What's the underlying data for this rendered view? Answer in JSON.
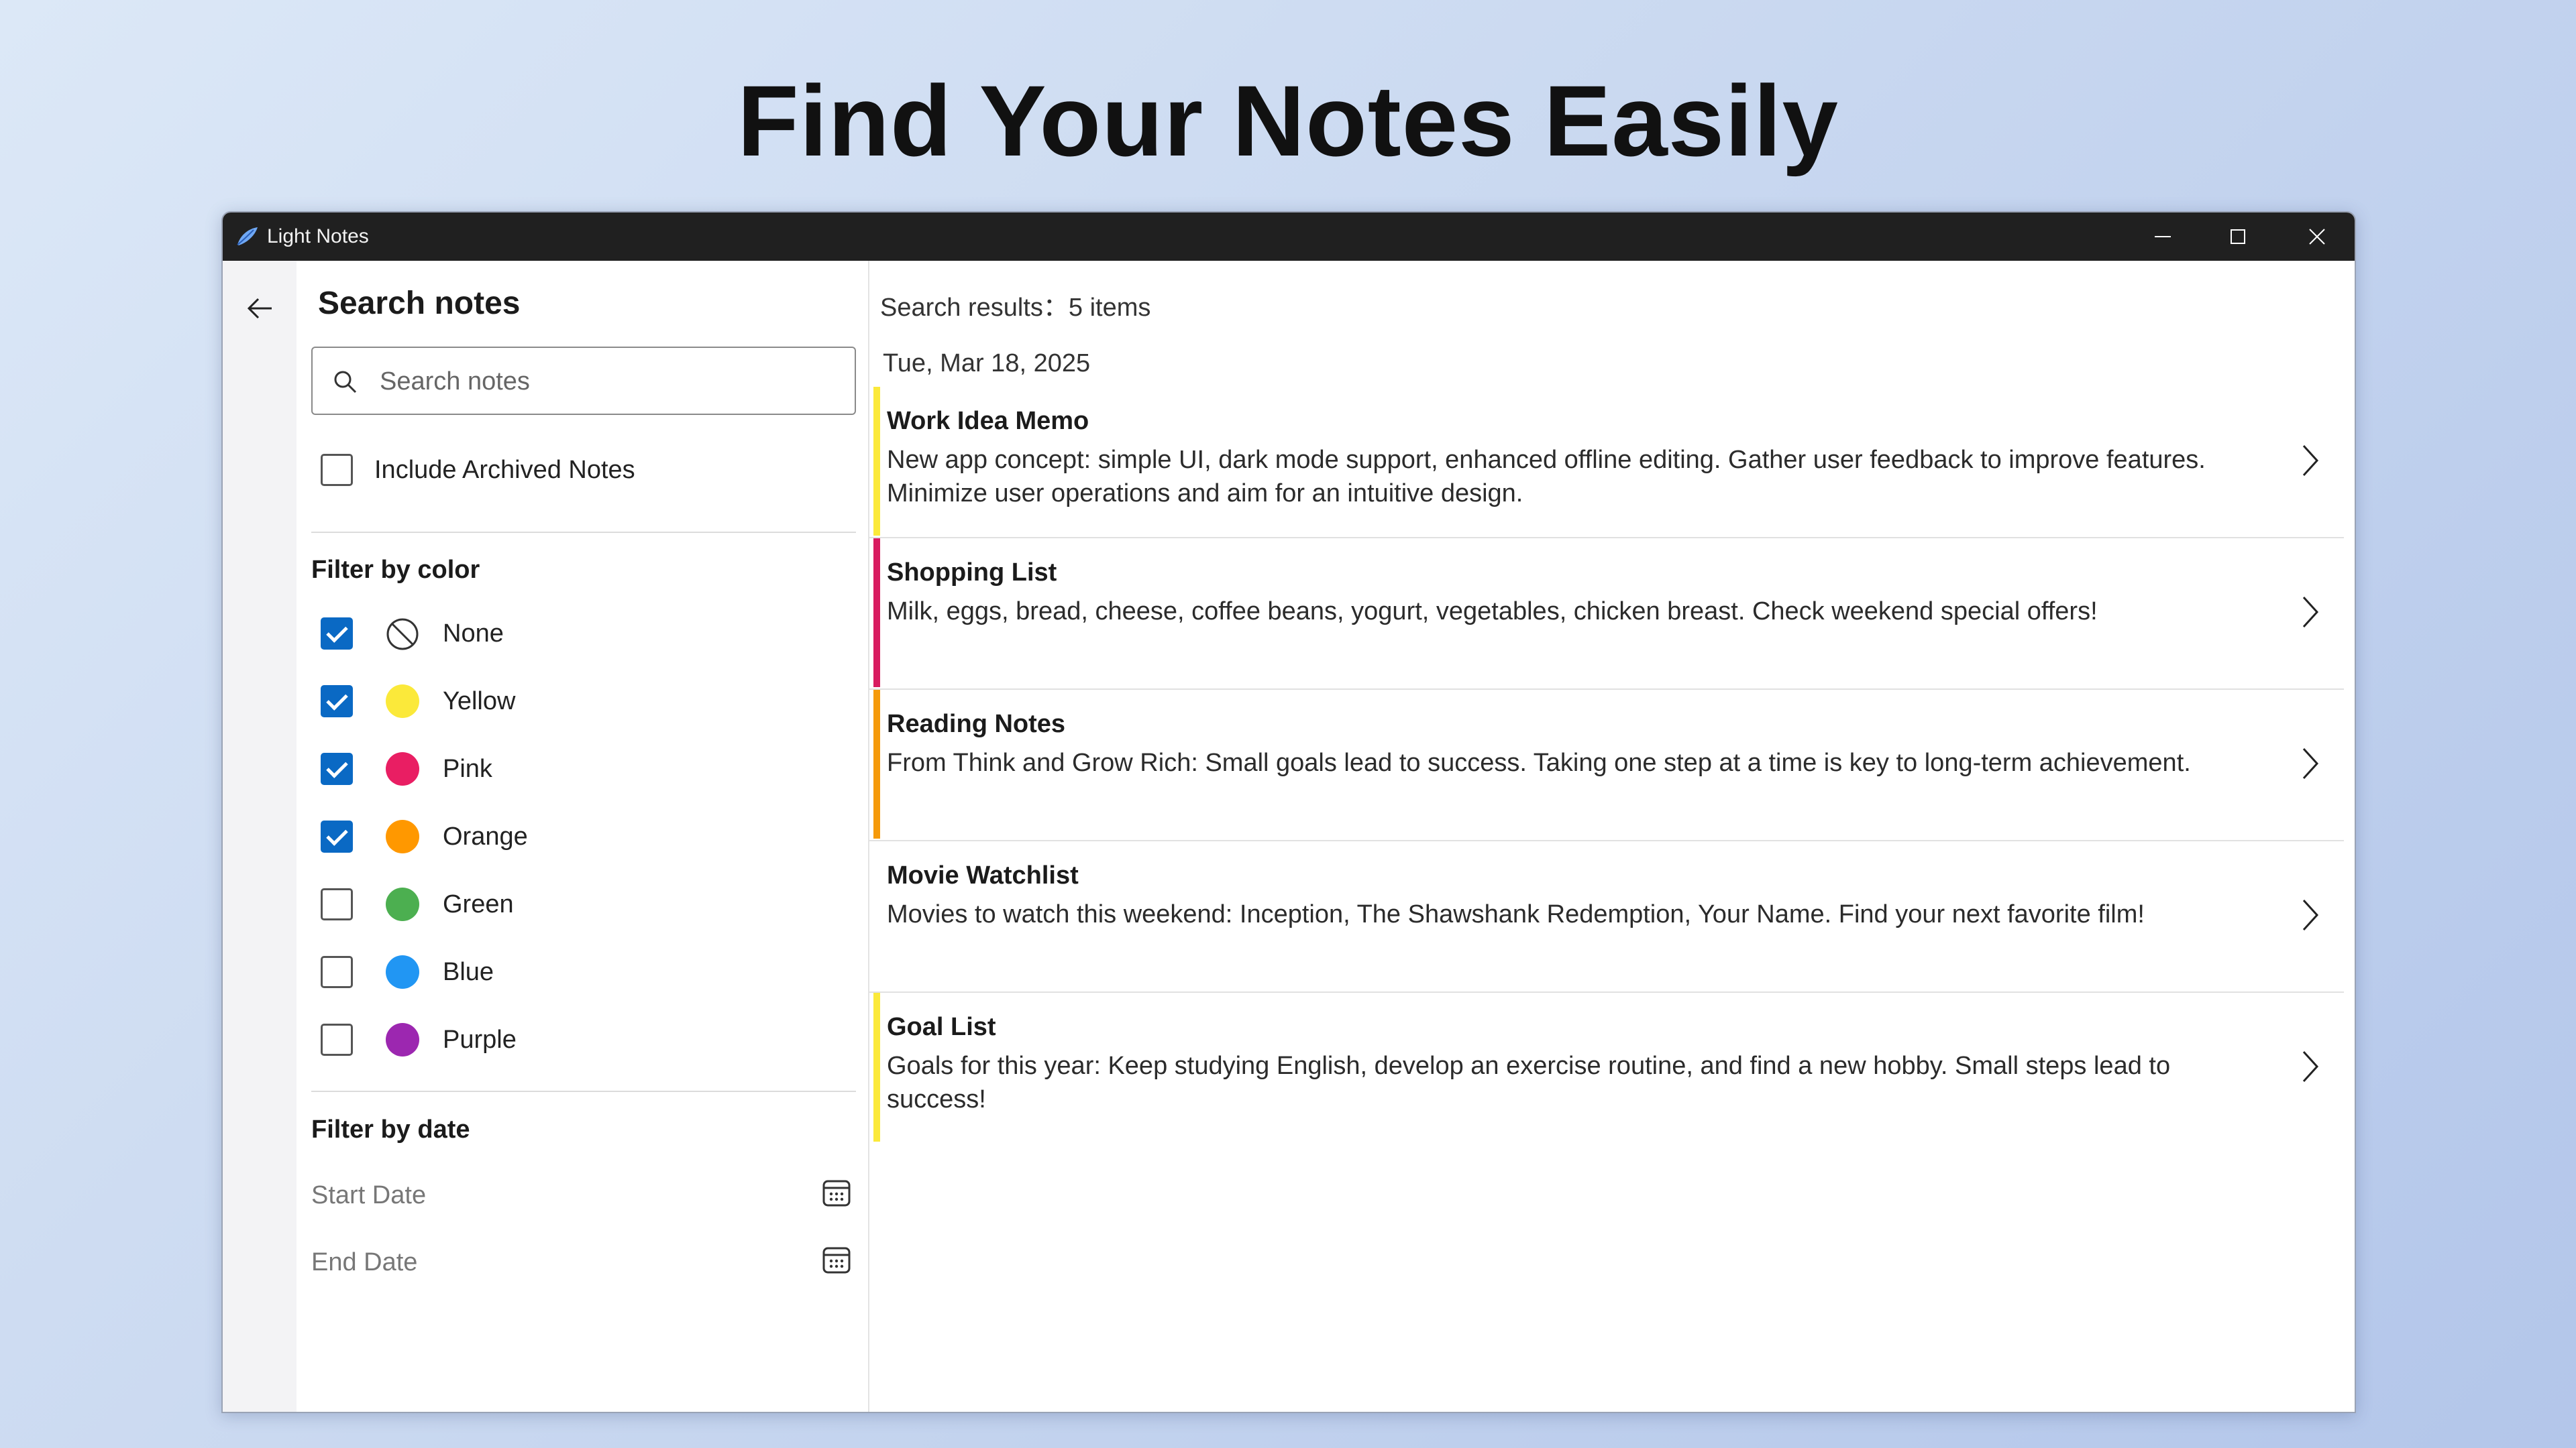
{
  "headline": "Find Your Notes Easily",
  "window": {
    "title": "Light Notes",
    "controls": [
      "minimize",
      "maximize",
      "close"
    ]
  },
  "search_panel": {
    "title": "Search notes",
    "search_placeholder": "Search notes",
    "include_archived_label": "Include Archived Notes",
    "include_archived_checked": false,
    "color_filter_title": "Filter by color",
    "colors": [
      {
        "label": "None",
        "checked": true,
        "color": "none"
      },
      {
        "label": "Yellow",
        "checked": true,
        "color": "#fbe93a"
      },
      {
        "label": "Pink",
        "checked": true,
        "color": "#e91e63"
      },
      {
        "label": "Orange",
        "checked": true,
        "color": "#ff9800"
      },
      {
        "label": "Green",
        "checked": false,
        "color": "#4caf50"
      },
      {
        "label": "Blue",
        "checked": false,
        "color": "#2196f3"
      },
      {
        "label": "Purple",
        "checked": false,
        "color": "#9c27b0"
      }
    ],
    "date_filter_title": "Filter by date",
    "start_date_label": "Start Date",
    "end_date_label": "End Date"
  },
  "results": {
    "count_text": "Search results：5 items",
    "date_group": "Tue, Mar 18, 2025",
    "notes": [
      {
        "title": "Work Idea Memo",
        "body": "New app concept: simple UI, dark mode support, enhanced offline editing. Gather user feedback to improve features. Minimize user operations and aim for an intuitive design.",
        "color": "#fbe93a"
      },
      {
        "title": "Shopping List",
        "body": "Milk, eggs, bread, cheese, coffee beans, yogurt, vegetables, chicken breast. Check weekend special offers!",
        "color": "#d81b60"
      },
      {
        "title": "Reading Notes",
        "body": "From Think and Grow Rich: Small goals lead to success. Taking one step at a time is key to long-term achievement.",
        "color": "#f59a0b"
      },
      {
        "title": "Movie Watchlist",
        "body": "Movies to watch this weekend: Inception, The Shawshank Redemption, Your Name. Find your next favorite film!",
        "color": "none"
      },
      {
        "title": "Goal List",
        "body": "Goals for this year: Keep studying English, develop an exercise routine, and find a new hobby. Small steps lead to success!",
        "color": "#fbe93a"
      }
    ]
  }
}
